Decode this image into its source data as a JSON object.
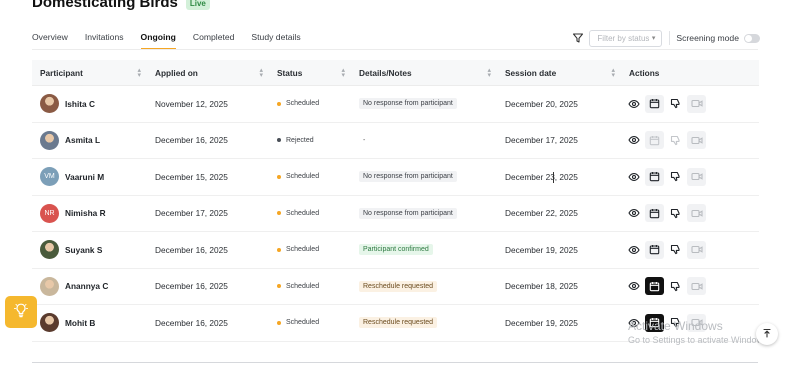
{
  "page": {
    "title": "Domesticating Birds",
    "badge": "Live"
  },
  "tabs": [
    {
      "label": "Overview",
      "active": false
    },
    {
      "label": "Invitations",
      "active": false
    },
    {
      "label": "Ongoing",
      "active": true
    },
    {
      "label": "Completed",
      "active": false
    },
    {
      "label": "Study details",
      "active": false
    }
  ],
  "toolbar": {
    "filter_placeholder": "Filter by status",
    "screening_label": "Screening mode",
    "screening_on": false
  },
  "table": {
    "headers": [
      "Participant",
      "Applied on",
      "Status",
      "Details/Notes",
      "Session date",
      "Actions"
    ],
    "rows": [
      {
        "name": "Ishita C",
        "avatar": "photo",
        "avatar_color": "#8a5a44",
        "applied": "November 12, 2025",
        "status": "Scheduled",
        "status_color": "#f5a623",
        "note": "No response from participant",
        "note_style": "neutral",
        "session": "December 20, 2025",
        "calendar_state": "normal"
      },
      {
        "name": "Asmita L",
        "avatar": "photo",
        "avatar_color": "#6b7a8f",
        "applied": "December 16, 2025",
        "status": "Rejected",
        "status_color": "#4a4f57",
        "note": "-",
        "note_style": "plain",
        "session": "December 17, 2025",
        "calendar_state": "disabled"
      },
      {
        "name": "Vaaruni M",
        "avatar": "VM",
        "avatar_color": "#7c9fb8",
        "applied": "December 15, 2025",
        "status": "Scheduled",
        "status_color": "#f5a623",
        "note": "No response from participant",
        "note_style": "neutral",
        "session": "December 23, 2025",
        "calendar_state": "normal"
      },
      {
        "name": "Nimisha R",
        "avatar": "NR",
        "avatar_color": "#d9534f",
        "applied": "December 17, 2025",
        "status": "Scheduled",
        "status_color": "#f5a623",
        "note": "No response from participant",
        "note_style": "neutral",
        "session": "December 22, 2025",
        "calendar_state": "normal"
      },
      {
        "name": "Suyank S",
        "avatar": "photo",
        "avatar_color": "#4a5b3c",
        "applied": "December 16, 2025",
        "status": "Scheduled",
        "status_color": "#f5a623",
        "note": "Participant confirmed",
        "note_style": "ok",
        "session": "December 19, 2025",
        "calendar_state": "normal"
      },
      {
        "name": "Anannya C",
        "avatar": "photo",
        "avatar_color": "#c9b79c",
        "applied": "December 16, 2025",
        "status": "Scheduled",
        "status_color": "#f5a623",
        "note": "Reschedule requested",
        "note_style": "warn",
        "session": "December 18, 2025",
        "calendar_state": "active"
      },
      {
        "name": "Mohit B",
        "avatar": "photo",
        "avatar_color": "#5a3b2e",
        "applied": "December 16, 2025",
        "status": "Scheduled",
        "status_color": "#f5a623",
        "note": "Reschedule requested",
        "note_style": "warn",
        "session": "December 19, 2025",
        "calendar_state": "active"
      }
    ]
  },
  "watermark": {
    "line1": "Activate Windows",
    "line2": "Go to Settings to activate Windows."
  },
  "colors": {
    "accent": "#f5a623",
    "badge_bg": "#d3f0d9"
  }
}
